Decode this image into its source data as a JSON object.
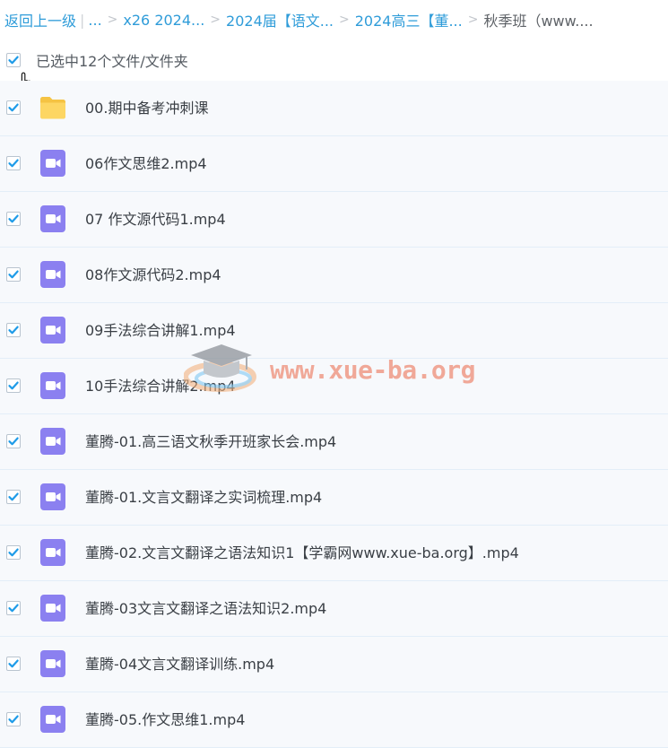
{
  "breadcrumb": {
    "back_label": "返回上一级",
    "ellipsis": "...",
    "items": [
      "x26 2024...",
      "2024届【语文...",
      "2024高三【董...",
      "秋季班（www...."
    ]
  },
  "selection": {
    "summary": "已选中12个文件/文件夹"
  },
  "watermark": {
    "text": "www.xue-ba.org"
  },
  "files": [
    {
      "name": "00.期中备考冲刺课",
      "icon": "folder-icon",
      "checked": true
    },
    {
      "name": "06作文思维2.mp4",
      "icon": "video-file-icon",
      "checked": true
    },
    {
      "name": "07 作文源代码1.mp4",
      "icon": "video-file-icon",
      "checked": true
    },
    {
      "name": "08作文源代码2.mp4",
      "icon": "video-file-icon",
      "checked": true
    },
    {
      "name": "09手法综合讲解1.mp4",
      "icon": "video-file-icon",
      "checked": true
    },
    {
      "name": "10手法综合讲解2.mp4",
      "icon": "video-file-icon",
      "checked": true
    },
    {
      "name": "董腾-01.高三语文秋季开班家长会.mp4",
      "icon": "video-file-icon",
      "checked": true
    },
    {
      "name": "董腾-01.文言文翻译之实词梳理.mp4",
      "icon": "video-file-icon",
      "checked": true
    },
    {
      "name": "董腾-02.文言文翻译之语法知识1【学霸网www.xue-ba.org】.mp4",
      "icon": "video-file-icon",
      "checked": true
    },
    {
      "name": "董腾-03文言文翻译之语法知识2.mp4",
      "icon": "video-file-icon",
      "checked": true
    },
    {
      "name": "董腾-04文言文翻译训练.mp4",
      "icon": "video-file-icon",
      "checked": true
    },
    {
      "name": "董腾-05.作文思维1.mp4",
      "icon": "video-file-icon",
      "checked": true
    }
  ],
  "colors": {
    "link": "#2f9cd9",
    "check": "#1e9be8",
    "video_icon": "#8b80f0",
    "folder_icon": "#fbd15a"
  }
}
